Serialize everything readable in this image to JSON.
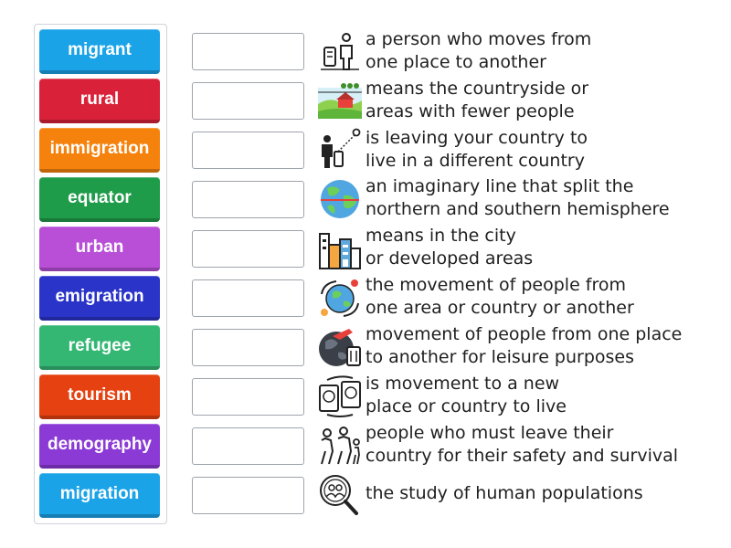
{
  "words": [
    {
      "label": "migrant",
      "color": "#1ba3e8"
    },
    {
      "label": "rural",
      "color": "#d9223a"
    },
    {
      "label": "immigration",
      "color": "#f5820d"
    },
    {
      "label": "equator",
      "color": "#1f9c4a"
    },
    {
      "label": "urban",
      "color": "#b84fd6"
    },
    {
      "label": "emigration",
      "color": "#2a34c8"
    },
    {
      "label": "refugee",
      "color": "#35b774"
    },
    {
      "label": "tourism",
      "color": "#e54111"
    },
    {
      "label": "demography",
      "color": "#8c3ad6"
    },
    {
      "label": "migration",
      "color": "#1ba3e8"
    }
  ],
  "definitions": [
    {
      "text": "a person who moves from\none place to another",
      "icon": "traveler-with-luggage-icon"
    },
    {
      "text": "means the countryside or\nareas with fewer people",
      "icon": "countryside-farm-icon"
    },
    {
      "text": "is leaving your country to\nlive in a different country",
      "icon": "person-with-suitcase-and-location-pin-icon"
    },
    {
      "text": "an imaginary line that split the\nnorthern and southern hemisphere",
      "icon": "globe-icon"
    },
    {
      "text": "means in the city\nor developed areas",
      "icon": "city-buildings-icon"
    },
    {
      "text": "the movement of people from\none area or country or another",
      "icon": "globe-with-people-arrows-icon"
    },
    {
      "text": "movement of people from one place\nto another for leisure purposes",
      "icon": "globe-airplane-luggage-icon"
    },
    {
      "text": "is movement to a new\nplace or country to live",
      "icon": "passports-exchange-icon"
    },
    {
      "text": "people who must leave their\ncountry for their safety and survival",
      "icon": "refugee-family-icon"
    },
    {
      "text": "the study of human populations",
      "icon": "magnifier-people-icon"
    }
  ]
}
